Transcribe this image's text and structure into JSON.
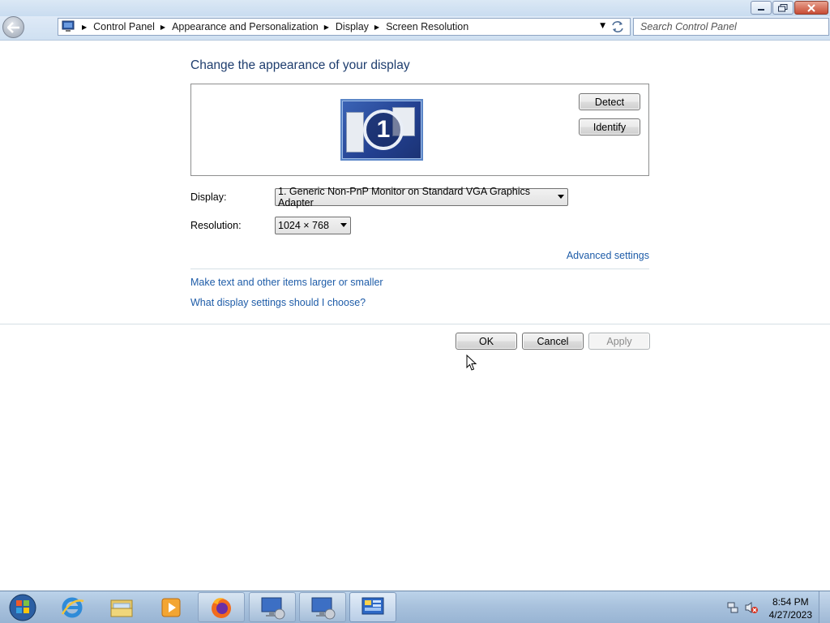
{
  "window": {
    "breadcrumbs": [
      "Control Panel",
      "Appearance and Personalization",
      "Display",
      "Screen Resolution"
    ],
    "search_placeholder": "Search Control Panel"
  },
  "main": {
    "heading": "Change the appearance of your display",
    "monitor_number": "1",
    "detect_label": "Detect",
    "identify_label": "Identify",
    "display_label": "Display:",
    "display_value": "1. Generic Non-PnP Monitor on Standard VGA Graphics Adapter",
    "resolution_label": "Resolution:",
    "resolution_value": "1024 × 768",
    "advanced_link": "Advanced settings",
    "text_size_link": "Make text and other items larger or smaller",
    "help_link": "What display settings should I choose?",
    "ok_label": "OK",
    "cancel_label": "Cancel",
    "apply_label": "Apply"
  },
  "taskbar": {
    "items": [
      "start-orb",
      "internet-explorer-icon",
      "file-explorer-icon",
      "media-player-icon",
      "firefox-icon",
      "display-settings-icon",
      "display-settings-icon",
      "control-panel-icon"
    ],
    "time": "8:54 PM",
    "date": "4/27/2023"
  },
  "colors": {
    "heading": "#1e3d6e",
    "link": "#1e5ca8",
    "taskbar": "#a9c2dd"
  }
}
